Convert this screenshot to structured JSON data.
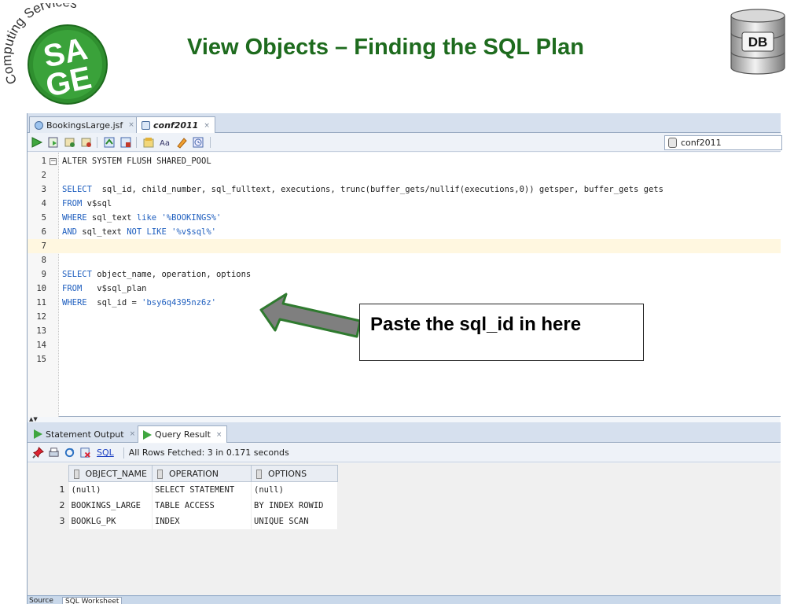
{
  "slide": {
    "title": "View Objects – Finding the SQL Plan",
    "logo_text": {
      "ring": "Computing Services",
      "word_top": "SA",
      "word_bottom": "GE"
    },
    "db_badge": "DB",
    "callout": "Paste the sql_id in here"
  },
  "ide": {
    "editor_tabs": [
      {
        "label": "BookingsLarge.jsf",
        "close": "×"
      },
      {
        "label": "conf2011",
        "close": "×"
      }
    ],
    "connection": "conf2011",
    "code_lines": [
      {
        "num": "1",
        "text": "ALTER SYSTEM FLUSH SHARED_POOL"
      },
      {
        "num": "2",
        "text": ""
      },
      {
        "num": "3",
        "text": "SELECT  sql_id, child_number, sql_fulltext, executions, trunc(buffer_gets/nullif(executions,0)) getsper, buffer_gets gets"
      },
      {
        "num": "4",
        "text": "FROM v$sql"
      },
      {
        "num": "5",
        "text": "WHERE sql_text like '%BOOKINGS%'"
      },
      {
        "num": "6",
        "text": "AND sql_text NOT LIKE '%v$sql%'"
      },
      {
        "num": "7",
        "text": ""
      },
      {
        "num": "8",
        "text": ""
      },
      {
        "num": "9",
        "text": "SELECT object_name, operation, options"
      },
      {
        "num": "10",
        "text": "FROM   v$sql_plan"
      },
      {
        "num": "11",
        "text": "WHERE  sql_id = 'bsy6q4395nz6z'"
      },
      {
        "num": "12",
        "text": ""
      },
      {
        "num": "13",
        "text": ""
      },
      {
        "num": "14",
        "text": ""
      },
      {
        "num": "15",
        "text": ""
      }
    ],
    "result_tabs": [
      {
        "label": "Statement Output",
        "close": "×"
      },
      {
        "label": "Query Result",
        "close": "×"
      }
    ],
    "result_toolbar": {
      "sql_link": "SQL",
      "status": "All Rows Fetched: 3 in 0.171 seconds"
    },
    "grid": {
      "columns": [
        "OBJECT_NAME",
        "OPERATION",
        "OPTIONS"
      ],
      "rows": [
        {
          "n": "1",
          "cells": [
            "(null)",
            "SELECT STATEMENT",
            "(null)"
          ]
        },
        {
          "n": "2",
          "cells": [
            "BOOKINGS_LARGE",
            "TABLE ACCESS",
            "BY INDEX ROWID"
          ]
        },
        {
          "n": "3",
          "cells": [
            "BOOKLG_PK",
            "INDEX",
            "UNIQUE SCAN"
          ]
        }
      ]
    },
    "bottom_tabs": [
      "Source",
      "SQL Worksheet"
    ]
  }
}
